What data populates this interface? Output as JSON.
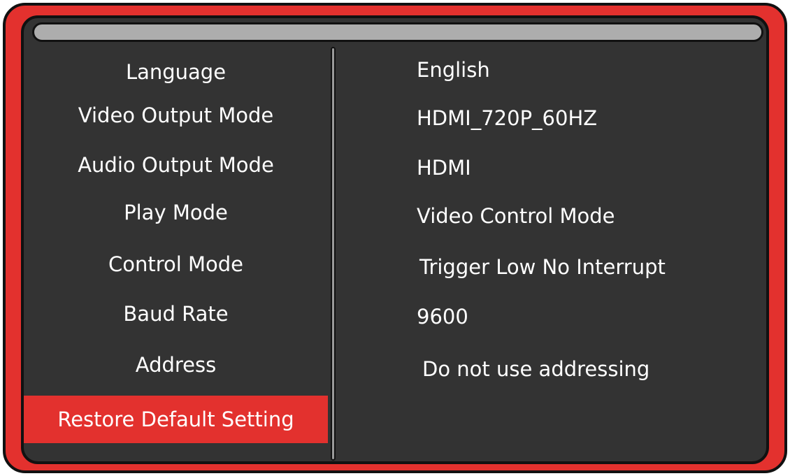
{
  "menu": {
    "items": [
      {
        "label": "Language",
        "value": "English"
      },
      {
        "label": "Video Output Mode",
        "value": "HDMI_720P_60HZ"
      },
      {
        "label": "Audio Output Mode",
        "value": "HDMI"
      },
      {
        "label": "Play Mode",
        "value": "Video Control Mode"
      },
      {
        "label": "Control Mode",
        "value": "Trigger Low No Interrupt"
      },
      {
        "label": "Baud Rate",
        "value": "9600"
      },
      {
        "label": "Address",
        "value": "Do not use addressing"
      },
      {
        "label": "Restore Default Setting",
        "value": ""
      }
    ],
    "selected_index": 7
  },
  "colors": {
    "frame": "#e3312e",
    "screen": "#333333",
    "highlight": "#e3312e",
    "text": "#ffffff"
  }
}
